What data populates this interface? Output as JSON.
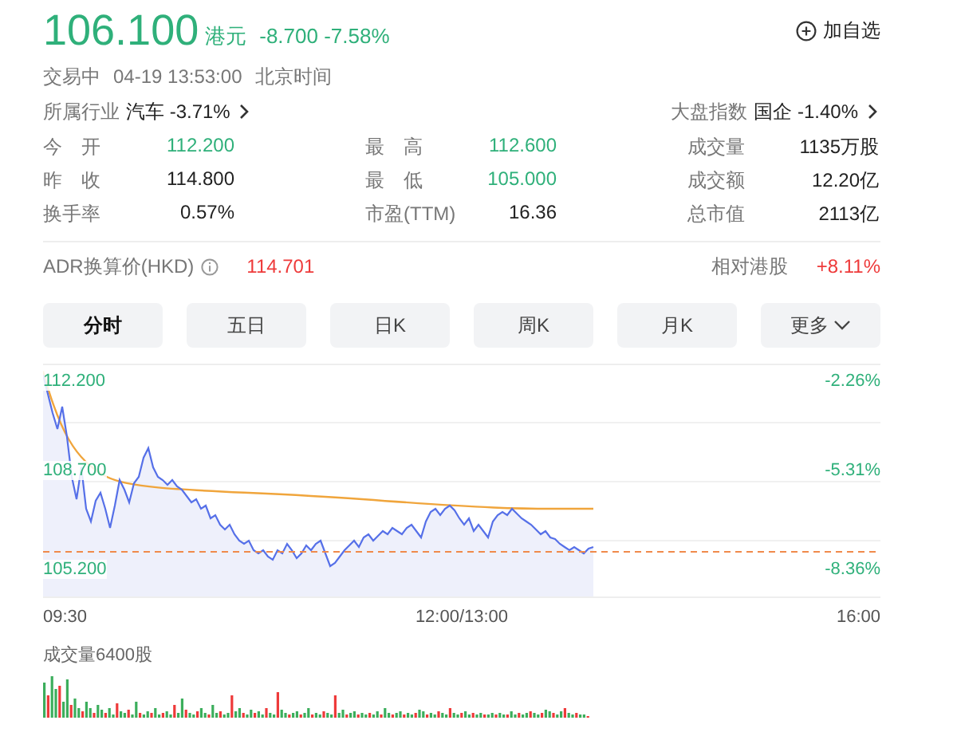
{
  "quote": {
    "price": "106.100",
    "currency": "港元",
    "change": "-8.700",
    "change_pct": "-7.58%",
    "color": "#2fb07a"
  },
  "watchlist_button": {
    "label": "加自选"
  },
  "status": {
    "state": "交易中",
    "time": "04-19 13:53:00",
    "zone": "北京时间"
  },
  "industry": {
    "label": "所属行业",
    "name": "汽车",
    "change": "-3.71%"
  },
  "index": {
    "label": "大盘指数",
    "name": "国企",
    "change": "-1.40%"
  },
  "stats": [
    {
      "label": "今　开",
      "value": "112.200",
      "color": "#2fb07a"
    },
    {
      "label": "最　高",
      "value": "112.600",
      "color": "#2fb07a"
    },
    {
      "label": "成交量",
      "value": "1135万股",
      "color": "#222222"
    },
    {
      "label": "昨　收",
      "value": "114.800",
      "color": "#222222"
    },
    {
      "label": "最　低",
      "value": "105.000",
      "color": "#2fb07a"
    },
    {
      "label": "成交额",
      "value": "12.20亿",
      "color": "#222222"
    },
    {
      "label": "换手率",
      "value": "0.57%",
      "color": "#222222"
    },
    {
      "label": "市盈(TTM)",
      "value": "16.36",
      "color": "#222222"
    },
    {
      "label": "总市值",
      "value": "2113亿",
      "color": "#222222"
    }
  ],
  "adr": {
    "label": "ADR换算价(HKD)",
    "value": "114.701",
    "color": "#ee3a3a",
    "relative": {
      "label": "相对港股",
      "value": "+8.11%",
      "color": "#ee3a3a"
    }
  },
  "tabs": [
    {
      "label": "分时",
      "selected": true
    },
    {
      "label": "五日",
      "selected": false
    },
    {
      "label": "日K",
      "selected": false
    },
    {
      "label": "周K",
      "selected": false
    },
    {
      "label": "月K",
      "selected": false
    },
    {
      "label": "更多",
      "selected": false,
      "dropdown": true
    }
  ],
  "price_chart": {
    "y_labels": [
      "112.200",
      "108.700",
      "105.200"
    ],
    "pct_labels": [
      "-2.26%",
      "-5.31%",
      "-8.36%"
    ],
    "x_labels": [
      "09:30",
      "12:00/13:00",
      "16:00"
    ]
  },
  "volume_chart": {
    "label": "成交量6400股"
  }
}
